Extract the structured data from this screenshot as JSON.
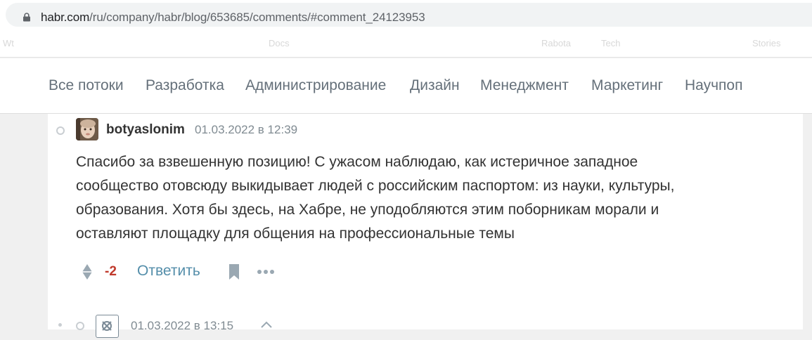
{
  "browser": {
    "url_host": "habr.com",
    "url_path": "/ru/company/habr/blog/653685/comments/#comment_24123953",
    "faded_bookmarks": [
      "Wt",
      "Docs",
      "Rabota",
      "Tech",
      "Stories"
    ]
  },
  "nav": {
    "items": [
      "Все потоки",
      "Разработка",
      "Администрирование",
      "Дизайн",
      "Менеджмент",
      "Маркетинг",
      "Научпоп"
    ]
  },
  "comment": {
    "author": "botyaslonim",
    "date": "01.03.2022 в 12:39",
    "text": "Спасибо за взвешенную позицию! С ужасом наблюдаю, как истеричное западное сообщество отовсюду выкидывает людей с российским паспортом: из науки, культуры, образования. Хотя бы здесь, на Хабре, не уподобляются этим поборникам морали и оставляют площадку для общения на профессиональные темы",
    "lines": [
      "Спасибо за взвешенную позицию! С ужасом наблюдаю, как истеричное западное",
      "сообщество отовсюду выкидывает людей с российским паспортом: из науки, культуры,",
      "образования. Хотя бы здесь, на Хабре, не уподобляются этим поборникам морали и",
      "оставляют площадку для общения на профессиональные темы"
    ],
    "score": "-2",
    "reply_label": "Ответить"
  },
  "next_comment": {
    "date": "01.03.2022 в 13:15"
  },
  "colors": {
    "nav_text": "#65707a",
    "score_negative": "#c0392b",
    "link": "#548eaa",
    "icon_gray": "#9aa8b2"
  }
}
